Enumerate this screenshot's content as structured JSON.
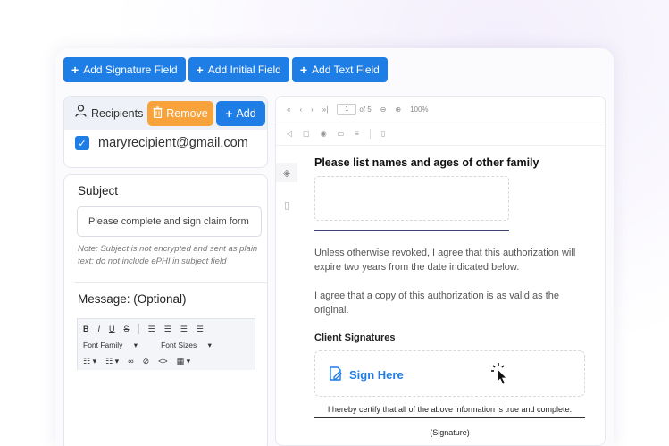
{
  "toolbar": {
    "add_signature": "Add Signature Field",
    "add_initial": "Add Initial Field",
    "add_text": "Add Text Field"
  },
  "recipients": {
    "label": "Recipients",
    "remove": "Remove",
    "add": "Add",
    "items": [
      {
        "email": "maryrecipient@gmail.com",
        "checked": true
      }
    ]
  },
  "subject": {
    "title": "Subject",
    "value": "Please complete and sign claim form",
    "note": "Note: Subject is not encrypted  and sent as plain text: do not include ePHI in subject field"
  },
  "message": {
    "title": "Message: (Optional)",
    "editor": {
      "bold": "B",
      "italic": "I",
      "underline": "U",
      "strike": "S",
      "font_family": "Font Family",
      "font_sizes": "Font Sizes"
    }
  },
  "viewer": {
    "page_input": "1",
    "page_of": "of 5",
    "zoom": "100%"
  },
  "document": {
    "heading": "Please list names and ages of other family",
    "para1": "Unless otherwise revoked, I agree that this authorization will expire two years from the date indicated below.",
    "para2": "I agree that a copy of this authorization is as valid as the original.",
    "sig_heading": "Client Signatures",
    "sign_here": "Sign Here",
    "certify": "I hereby certify that all of the above information is true and complete.",
    "sig_label": "(Signature)"
  },
  "colors": {
    "primary": "#1e7ee6",
    "warning": "#f7a23a"
  }
}
